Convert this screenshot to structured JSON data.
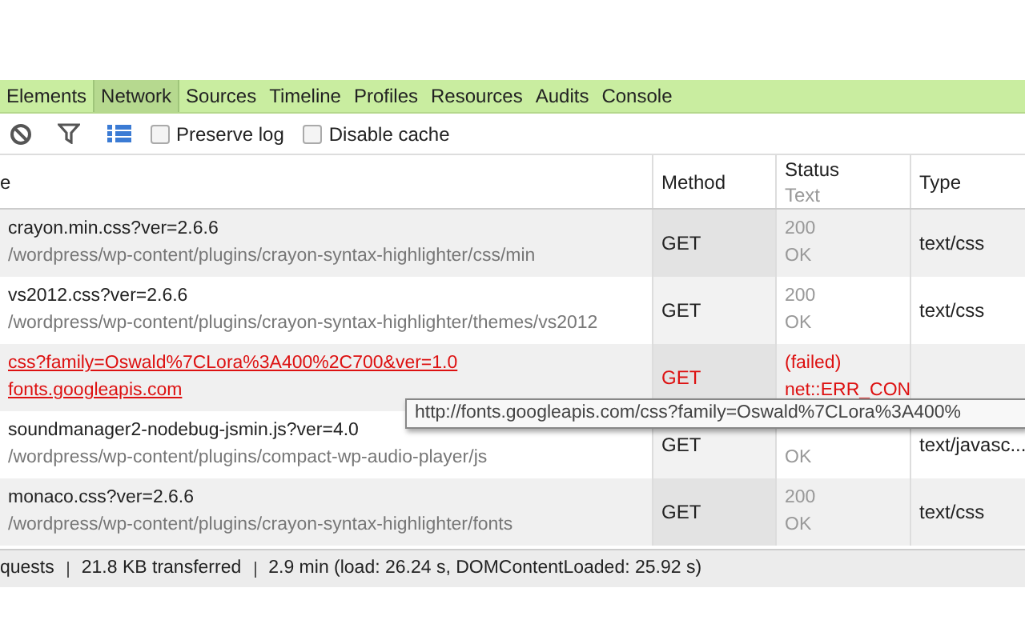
{
  "tabs": [
    {
      "label": "Elements",
      "selected": false
    },
    {
      "label": "Network",
      "selected": true
    },
    {
      "label": "Sources",
      "selected": false
    },
    {
      "label": "Timeline",
      "selected": false
    },
    {
      "label": "Profiles",
      "selected": false
    },
    {
      "label": "Resources",
      "selected": false
    },
    {
      "label": "Audits",
      "selected": false
    },
    {
      "label": "Console",
      "selected": false
    }
  ],
  "toolbar": {
    "large_rows_on": true,
    "checkboxes": [
      {
        "label": "Preserve log",
        "checked": false
      },
      {
        "label": "Disable cache",
        "checked": false
      }
    ]
  },
  "columns": [
    {
      "label": "e"
    },
    {
      "label": "Method"
    },
    {
      "label": "Status",
      "sub": "Text"
    },
    {
      "label": "Type"
    }
  ],
  "rows": [
    {
      "name": "crayon.min.css?ver=2.6.6",
      "path": "/wordpress/wp-content/plugins/crayon-syntax-highlighter/css/min",
      "method": "GET",
      "status": "200",
      "status_text": "OK",
      "type": "text/css",
      "failed": false
    },
    {
      "name": "vs2012.css?ver=2.6.6",
      "path": "/wordpress/wp-content/plugins/crayon-syntax-highlighter/themes/vs2012",
      "method": "GET",
      "status": "200",
      "status_text": "OK",
      "type": "text/css",
      "failed": false
    },
    {
      "name": "css?family=Oswald%7CLora%3A400%2C700&ver=1.0",
      "path": "fonts.googleapis.com",
      "method": "GET",
      "status": "(failed)",
      "status_text": "net::ERR_CON",
      "type": "",
      "failed": true
    },
    {
      "name": "soundmanager2-nodebug-jsmin.js?ver=4.0",
      "path": "/wordpress/wp-content/plugins/compact-wp-audio-player/js",
      "method": "GET",
      "status_text": "OK",
      "type": "text/javasc...",
      "failed": false
    },
    {
      "name": "monaco.css?ver=2.6.6",
      "path": "/wordpress/wp-content/plugins/crayon-syntax-highlighter/fonts",
      "method": "GET",
      "status": "200",
      "status_text": "OK",
      "type": "text/css",
      "failed": false
    }
  ],
  "tooltip": "http://fonts.googleapis.com/css?family=Oswald%7CLora%3A400%",
  "status_bar": [
    "quests",
    "21.8 KB transferred",
    "2.9 min (load: 26.24 s, DOMContentLoaded: 25.92 s)"
  ]
}
